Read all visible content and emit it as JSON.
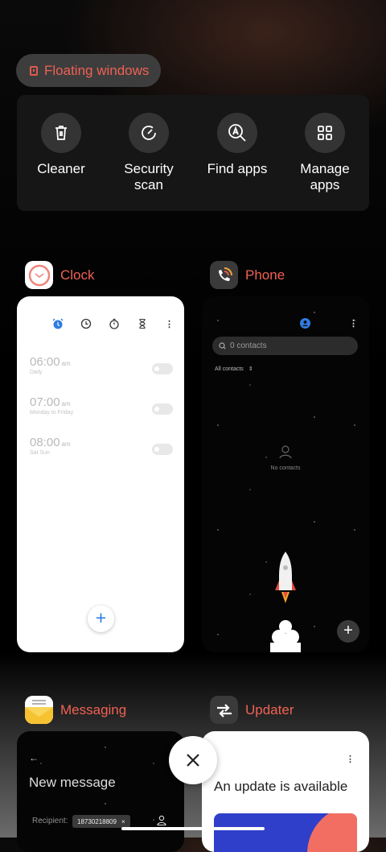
{
  "floating_windows": {
    "label": "Floating windows"
  },
  "tools": [
    {
      "label": "Cleaner",
      "icon": "trash-icon"
    },
    {
      "label": "Security\nscan",
      "icon": "security-scan-icon"
    },
    {
      "label": "Find apps",
      "icon": "find-apps-icon"
    },
    {
      "label": "Manage\napps",
      "icon": "grid-icon"
    }
  ],
  "apps": {
    "clock": {
      "name": "Clock",
      "alarms": [
        {
          "time": "06:00",
          "ampm": "am",
          "repeat": "Daily"
        },
        {
          "time": "07:00",
          "ampm": "am",
          "repeat": "Monday to Friday"
        },
        {
          "time": "08:00",
          "ampm": "am",
          "repeat": "Sat Sun"
        }
      ],
      "fab": "+"
    },
    "phone": {
      "name": "Phone",
      "search_placeholder": "0 contacts",
      "filter": "All contacts",
      "empty": "No contacts",
      "fab": "+"
    },
    "messaging": {
      "name": "Messaging",
      "back": "←",
      "title": "New message",
      "recipient_label": "Recipient:",
      "recipient": "18730218809",
      "chip_remove": "×"
    },
    "updater": {
      "name": "Updater",
      "menu": "⋮",
      "title": "An update is available"
    }
  },
  "colors": {
    "accent_red": "#f06154",
    "clock_blue": "#2f7de1",
    "card_dark": "#050505"
  },
  "close_label": "×"
}
